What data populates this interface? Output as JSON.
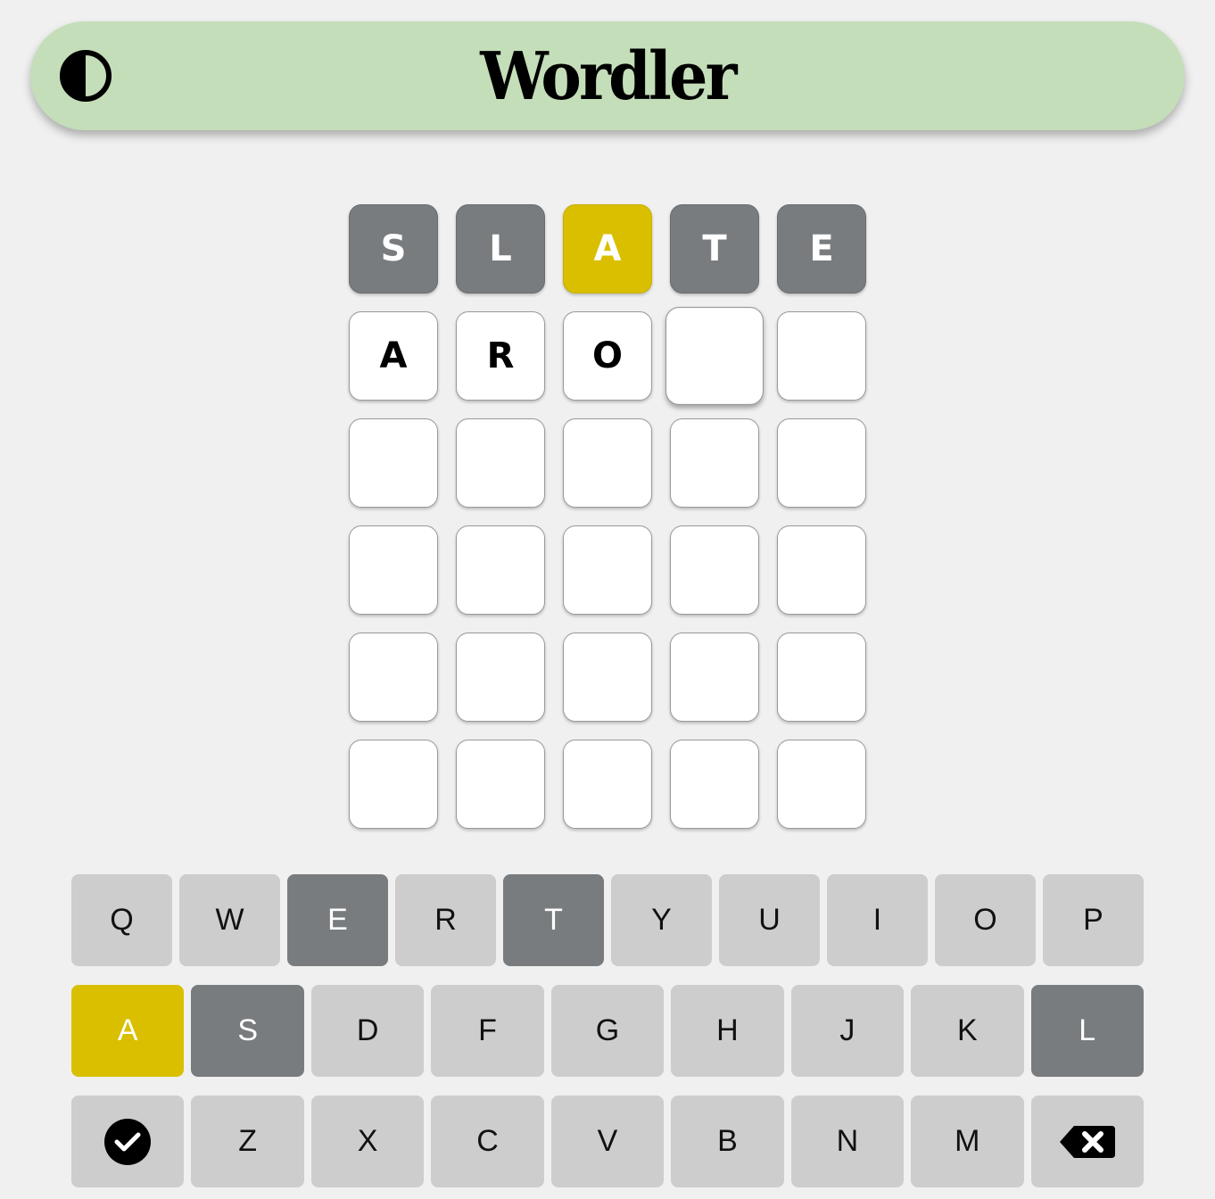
{
  "header": {
    "title": "Wordler",
    "theme_toggle_icon": "contrast-icon"
  },
  "colors": {
    "absent": "#787c7f",
    "present": "#d9bf00",
    "header_bg": "#c4deb9",
    "key_default": "#cdcdcd"
  },
  "board": {
    "rows": [
      [
        {
          "letter": "S",
          "state": "absent"
        },
        {
          "letter": "L",
          "state": "absent"
        },
        {
          "letter": "A",
          "state": "present"
        },
        {
          "letter": "T",
          "state": "absent"
        },
        {
          "letter": "E",
          "state": "absent"
        }
      ],
      [
        {
          "letter": "A",
          "state": "filled"
        },
        {
          "letter": "R",
          "state": "filled"
        },
        {
          "letter": "O",
          "state": "filled"
        },
        {
          "letter": "",
          "state": "active"
        },
        {
          "letter": "",
          "state": "empty"
        }
      ],
      [
        {
          "letter": "",
          "state": "empty"
        },
        {
          "letter": "",
          "state": "empty"
        },
        {
          "letter": "",
          "state": "empty"
        },
        {
          "letter": "",
          "state": "empty"
        },
        {
          "letter": "",
          "state": "empty"
        }
      ],
      [
        {
          "letter": "",
          "state": "empty"
        },
        {
          "letter": "",
          "state": "empty"
        },
        {
          "letter": "",
          "state": "empty"
        },
        {
          "letter": "",
          "state": "empty"
        },
        {
          "letter": "",
          "state": "empty"
        }
      ],
      [
        {
          "letter": "",
          "state": "empty"
        },
        {
          "letter": "",
          "state": "empty"
        },
        {
          "letter": "",
          "state": "empty"
        },
        {
          "letter": "",
          "state": "empty"
        },
        {
          "letter": "",
          "state": "empty"
        }
      ],
      [
        {
          "letter": "",
          "state": "empty"
        },
        {
          "letter": "",
          "state": "empty"
        },
        {
          "letter": "",
          "state": "empty"
        },
        {
          "letter": "",
          "state": "empty"
        },
        {
          "letter": "",
          "state": "empty"
        }
      ]
    ]
  },
  "keyboard": {
    "rows": [
      [
        {
          "label": "Q",
          "state": "default"
        },
        {
          "label": "W",
          "state": "default"
        },
        {
          "label": "E",
          "state": "absent"
        },
        {
          "label": "R",
          "state": "default"
        },
        {
          "label": "T",
          "state": "absent"
        },
        {
          "label": "Y",
          "state": "default"
        },
        {
          "label": "U",
          "state": "default"
        },
        {
          "label": "I",
          "state": "default"
        },
        {
          "label": "O",
          "state": "default"
        },
        {
          "label": "P",
          "state": "default"
        }
      ],
      [
        {
          "label": "A",
          "state": "present"
        },
        {
          "label": "S",
          "state": "absent"
        },
        {
          "label": "D",
          "state": "default"
        },
        {
          "label": "F",
          "state": "default"
        },
        {
          "label": "G",
          "state": "default"
        },
        {
          "label": "H",
          "state": "default"
        },
        {
          "label": "J",
          "state": "default"
        },
        {
          "label": "K",
          "state": "default"
        },
        {
          "label": "L",
          "state": "absent"
        }
      ],
      [
        {
          "label": "",
          "icon": "check-circle-icon",
          "state": "default",
          "action": "enter"
        },
        {
          "label": "Z",
          "state": "default"
        },
        {
          "label": "X",
          "state": "default"
        },
        {
          "label": "C",
          "state": "default"
        },
        {
          "label": "V",
          "state": "default"
        },
        {
          "label": "B",
          "state": "default"
        },
        {
          "label": "N",
          "state": "default"
        },
        {
          "label": "M",
          "state": "default"
        },
        {
          "label": "",
          "icon": "backspace-icon",
          "state": "default",
          "action": "backspace"
        }
      ]
    ]
  }
}
